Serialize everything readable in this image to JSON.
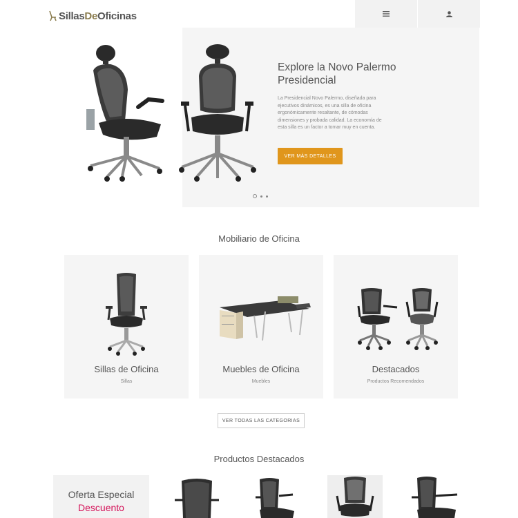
{
  "header": {
    "logo_part1": "Sillas",
    "logo_part2": "De",
    "logo_part3": "Oficinas",
    "menu_icon": "hamburger-icon",
    "user_icon": "user-icon"
  },
  "hero": {
    "title": "Explore la Novo Palermo Presidencial",
    "description": "La Presidencial Novo Palermo, diseñada para ejecutivos dinámicos, es una silla de oficina ergonómicamente resaltante, de cómodas dimensiones y probada calidad. La economía de esta silla es un factor a tomar muy en cuenta.",
    "button_label": "VER MÁS DETALLES",
    "slides_count": 3,
    "active_slide": 1
  },
  "categories_section": {
    "title": "Mobiliario de Oficina",
    "cards": [
      {
        "title": "Sillas de Oficina",
        "subtitle": "Sillas"
      },
      {
        "title": "Muebles de Oficina",
        "subtitle": "Muebles"
      },
      {
        "title": "Destacados",
        "subtitle": "Productos Recomendados"
      }
    ],
    "all_button_label": "VER TODAS LAS CATEGORIAS"
  },
  "featured_section": {
    "title": "Productos Destacados",
    "offer_line1": "Oferta Especial",
    "offer_line2": "Descuento"
  },
  "colors": {
    "accent": "#e0961c",
    "discount": "#d4145a",
    "logo_accent": "#8a7c4e"
  }
}
